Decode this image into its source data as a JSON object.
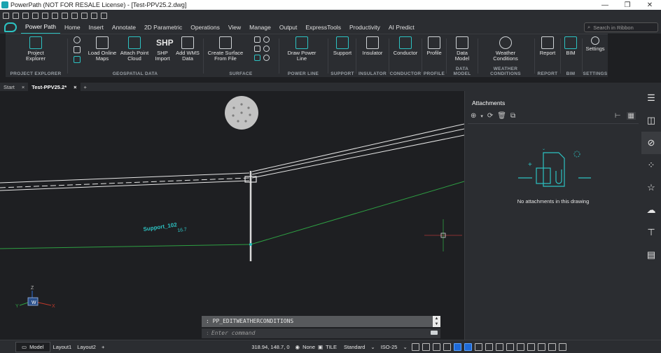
{
  "app": {
    "window_title": "PowerPath (NOT FOR RESALE License) - [Test-PPV25.2.dwg]",
    "accent": "#2cc2c2"
  },
  "ribbon_tabs": [
    "Power Path",
    "Home",
    "Insert",
    "Annotate",
    "2D Parametric",
    "Operations",
    "View",
    "Manage",
    "Output",
    "ExpressTools",
    "Productivity",
    "AI Predict"
  ],
  "ribbon_search": {
    "placeholder": "Search in Ribbon"
  },
  "ribbon": {
    "project_explorer": {
      "group": "PROJECT EXPLORER",
      "button": "Project Explorer"
    },
    "geospatial": {
      "group": "GEOSPATIAL DATA",
      "load_maps": "Load Online Maps",
      "attach_cloud": "Attach Point Cloud",
      "shp_import": "SHP Import",
      "shp_glyph": "SHP",
      "add_wms": "Add WMS Data"
    },
    "surface": {
      "group": "SURFACE",
      "create_surface": "Create Surface From File"
    },
    "power_line": {
      "group": "POWER LINE",
      "draw": "Draw Power Line"
    },
    "support": {
      "group": "SUPPORT",
      "button": "Support"
    },
    "insulator": {
      "group": "INSULATOR",
      "button": "Insulator"
    },
    "conductor": {
      "group": "CONDUCTOR",
      "button": "Conductor"
    },
    "profile": {
      "group": "PROFILE",
      "button": "Profile"
    },
    "data_model": {
      "group": "DATA MODEL",
      "button": "Data Model"
    },
    "weather": {
      "group": "WEATHER CONDITIONS",
      "button": "Weather Conditions"
    },
    "report": {
      "group": "REPORT",
      "button": "Report"
    },
    "bim": {
      "group": "BIM",
      "button": "BIM"
    },
    "settings": {
      "group": "SETTINGS",
      "button": "Settings"
    }
  },
  "doc_tabs": [
    {
      "label": "Start",
      "close": "×"
    },
    {
      "label": "Test-PPV25.2*",
      "close": "×"
    }
  ],
  "canvas": {
    "support_label": "Support_102",
    "support_label_2": "16.7",
    "ucs_x": "X",
    "ucs_y": "Y",
    "ucs_z": "Z",
    "ucs_w": "W",
    "line_color_green": "#2ea043",
    "label_color": "#2cc2c2"
  },
  "attachments": {
    "title": "Attachments",
    "empty_text": "No attachments in this drawing"
  },
  "command": {
    "history": ": PP_EDITWEATHERCONDITIONS",
    "prompt": ":",
    "placeholder": "Enter command"
  },
  "status": {
    "model": "Model",
    "layout1": "Layout1",
    "layout2": "Layout2",
    "add": "+",
    "coords": "318.94, 148.7, 0",
    "lineweight": "None",
    "tile": "TILE",
    "text_style": "Standard",
    "dim_style": "ISO-25"
  }
}
